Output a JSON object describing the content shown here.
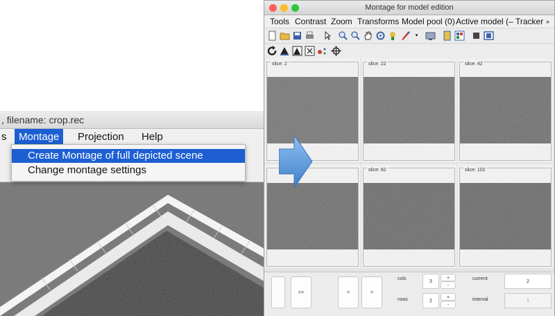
{
  "left_window": {
    "title": ", filename: crop.rec",
    "menu": [
      "s",
      "Montage",
      "Projection",
      "Help"
    ],
    "active_menu": "Montage",
    "montage_menu_items": [
      "Create Montage of full depicted scene",
      "Change montage settings"
    ]
  },
  "right_window": {
    "title": "Montage for model edition",
    "menu": [
      "Tools",
      "Contrast",
      "Zoom",
      "Transforms",
      "Model pool (0)",
      "Active model (–",
      "Tracker"
    ],
    "menu_overflow": "»",
    "slices": [
      {
        "label": "slice: 2"
      },
      {
        "label": "slice: 22"
      },
      {
        "label": "slice: 42"
      },
      {
        "label": ""
      },
      {
        "label": "slice: 82"
      },
      {
        "label": "slice: 102"
      }
    ],
    "controls": {
      "next_label": ">>",
      "prev_single": "<",
      "next_single": ">",
      "cols_label": "cols",
      "cols_value": "3",
      "rows_label": "rows",
      "rows_value": "2",
      "plus": "+",
      "minus": "-",
      "current_label": "current",
      "current_value": "2",
      "interval_label": "interval",
      "interval_value": "1"
    }
  },
  "colors": {
    "menu_highlight": "#1d5fd3",
    "arrow_fill": "#4a90d9",
    "traffic_close": "#fc5f57",
    "traffic_min": "#fdbc2e",
    "traffic_max": "#29c840"
  }
}
